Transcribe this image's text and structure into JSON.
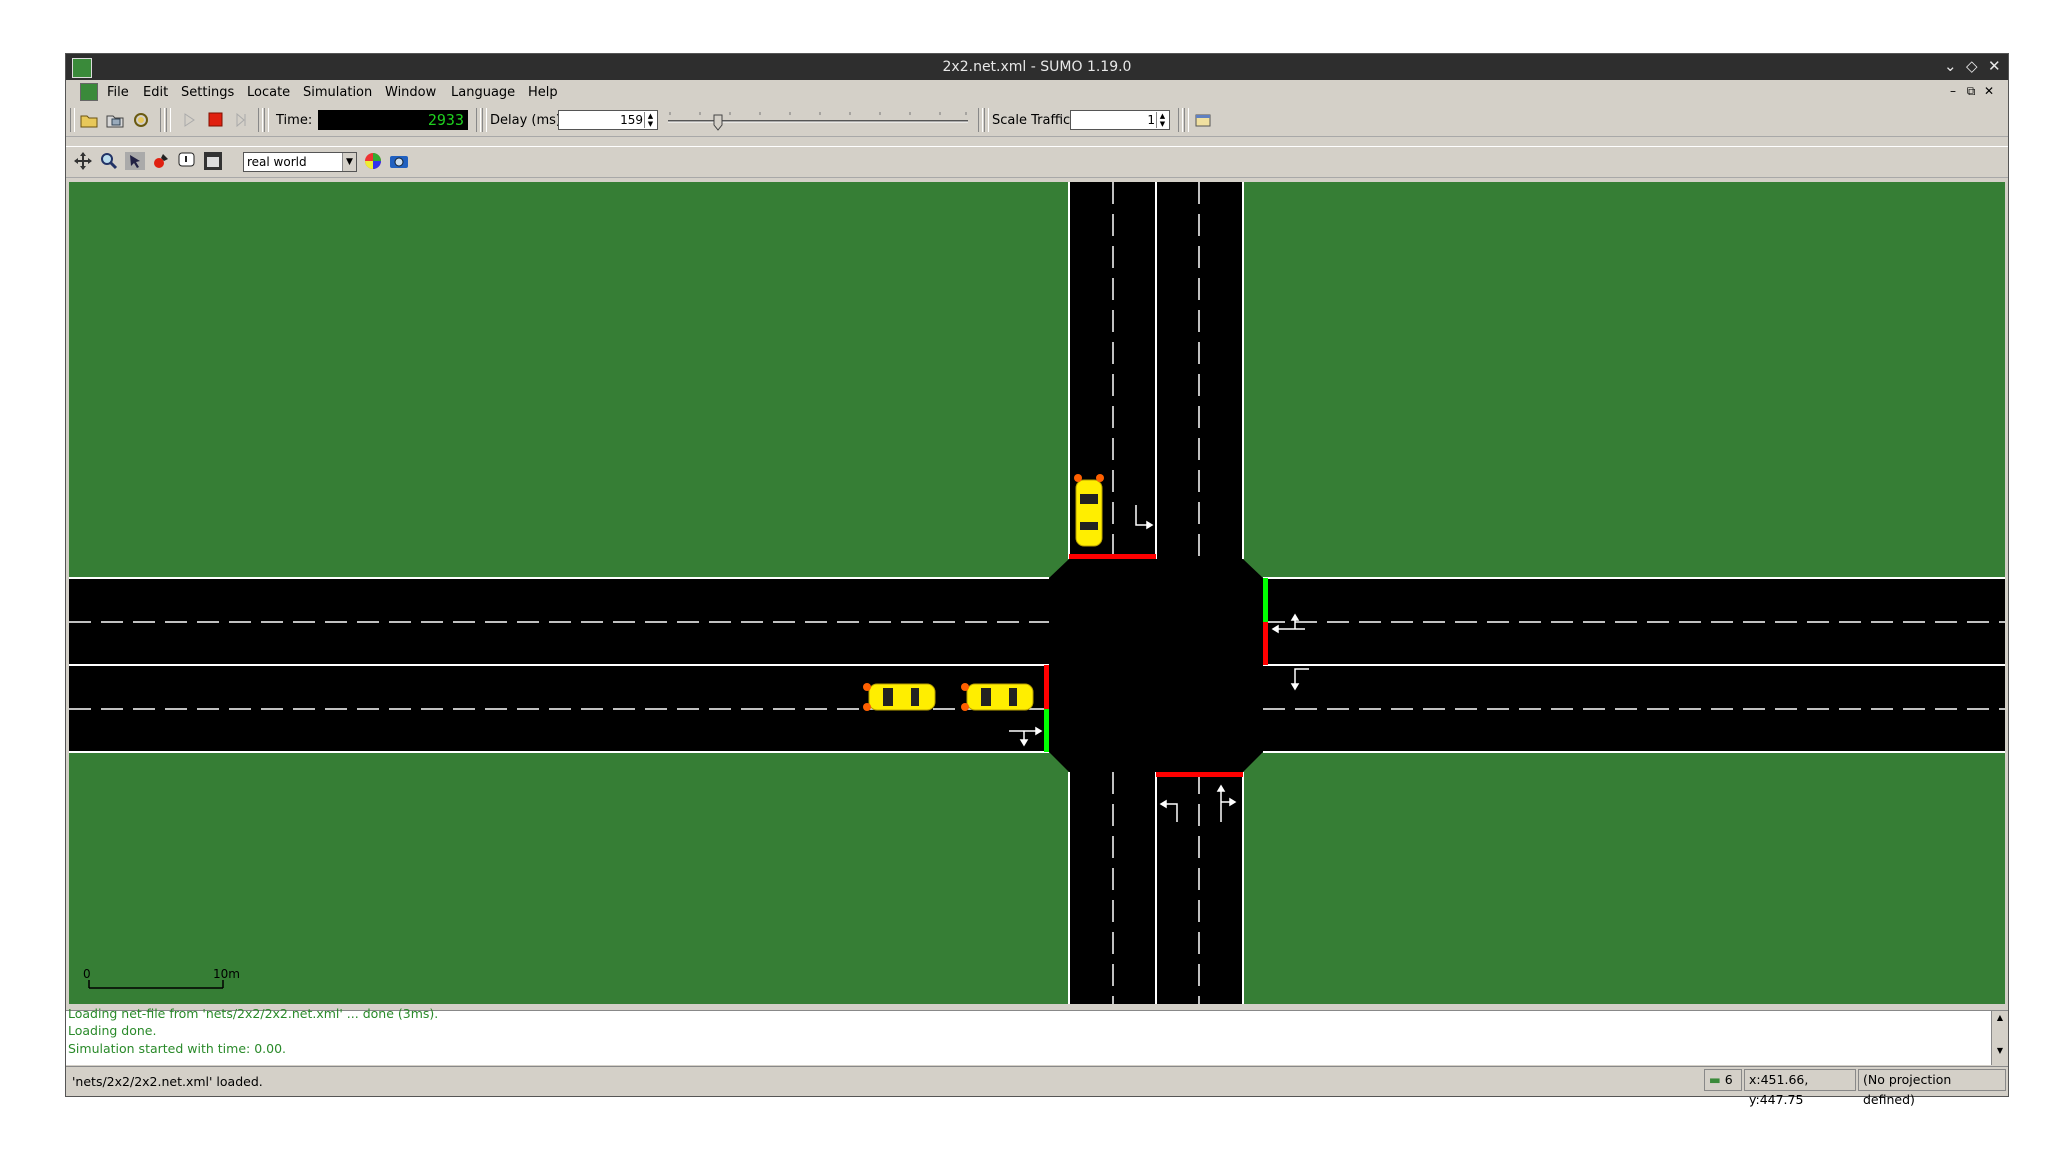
{
  "window": {
    "title": "2x2.net.xml - SUMO 1.19.0",
    "controls": [
      "minimize-icon",
      "maximize-icon",
      "close-icon"
    ]
  },
  "menubar": {
    "items": [
      "File",
      "Edit",
      "Settings",
      "Locate",
      "Simulation",
      "Window",
      "Language",
      "Help"
    ]
  },
  "toolbar": {
    "time_label": "Time:",
    "time_value": "2933",
    "delay_label": "Delay (ms):",
    "delay_value": "159",
    "scale_label": "Scale Traffic:",
    "scale_value": "1",
    "icons": [
      "open-folder-icon",
      "open-config-icon",
      "reload-icon",
      "play-icon",
      "stop-icon",
      "step-icon",
      "edit-chosen-icon"
    ]
  },
  "view_toolbar": {
    "icons": [
      "recenter-icon",
      "zoom-icon",
      "locate-icon",
      "edit-breakpoint-icon",
      "toggle-tooltip-icon",
      "editor-icon",
      "color-wheel-icon",
      "screenshot-icon"
    ],
    "scheme": "real world"
  },
  "canvas": {
    "scale_start": "0",
    "scale_end": "10m",
    "colors": {
      "grass": "#367e35",
      "road": "#000000",
      "lane_mark": "#ffffff",
      "signal_red": "#ff0000",
      "signal_green": "#00ff00",
      "vehicle": "#ffff00"
    },
    "vehicles_visible": 3
  },
  "messages": [
    "Loading net-file from 'nets/2x2/2x2.net.xml' ... done (3ms).",
    "Loading done.",
    "Simulation started with time: 0.00."
  ],
  "statusbar": {
    "message": "'nets/2x2/2x2.net.xml' loaded.",
    "vehicle_count": "6",
    "coords": "x:451.66, y:447.75",
    "projection": "(No projection defined)"
  }
}
